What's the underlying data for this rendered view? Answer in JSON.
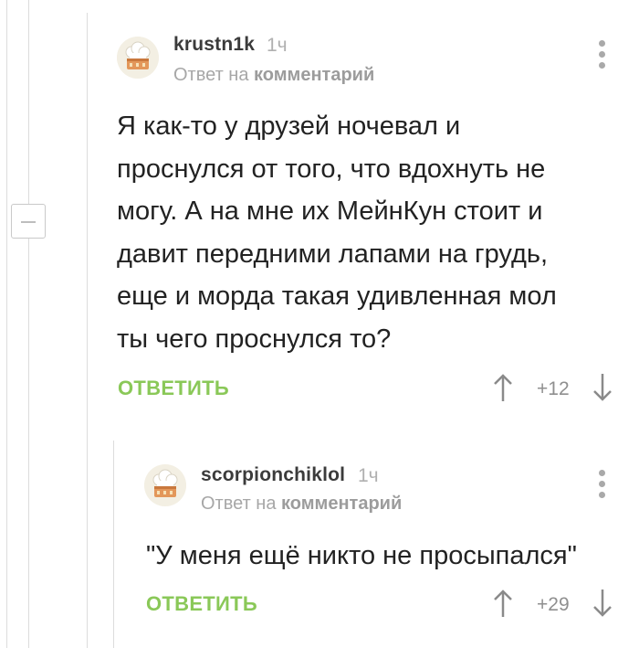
{
  "comments": [
    {
      "author": "krustn1k",
      "time": "1ч",
      "reply_prefix": "Ответ на",
      "reply_target": "комментарий",
      "text": "Я как-то у друзей ночевал и\nпроснулся от того, что вдохнуть не\nмогу. А на мне их МейнКун стоит и\nдавит передними лапами на грудь,\nеще и морда такая удивленная мол\nты чего проснулся то?",
      "reply_label": "ОТВЕТИТЬ",
      "rating": "+12"
    },
    {
      "author": "scorpionchiklol",
      "time": "1ч",
      "reply_prefix": "Ответ на",
      "reply_target": "комментарий",
      "text": "\"У меня ещё никто не просыпался\"",
      "reply_label": "ОТВЕТИТЬ",
      "rating": "+29"
    }
  ],
  "icons": {
    "avatar": "chef-hat-cake-avatar",
    "menu": "vertical-dots-icon",
    "upvote": "arrow-up-icon",
    "downvote": "arrow-down-icon",
    "collapse": "minus-icon"
  },
  "colors": {
    "reply_button": "#8ac858",
    "thread_line": "#dcdcdc",
    "text": "#222222",
    "muted": "#a7a7a7"
  }
}
